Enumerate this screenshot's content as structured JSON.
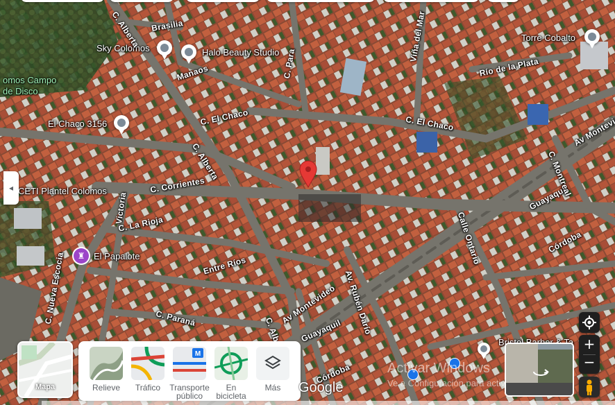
{
  "map": {
    "type": "satellite",
    "colors": {
      "roads": "#7a7870",
      "roofs": "#b5553b",
      "trees": "#2f4a24",
      "pin": "#e53935"
    }
  },
  "pois": [
    {
      "name": "Sky Colomos"
    },
    {
      "name": "Halo Beauty Studio"
    },
    {
      "name": "Torre Cobalto"
    },
    {
      "name": "El Chaco 3156"
    },
    {
      "name": "CETI Plantel Colomos"
    },
    {
      "name": "El Papalote"
    },
    {
      "name": "Bristol Barber & Ta"
    },
    {
      "name": "omos Campo de Disco"
    }
  ],
  "streets": [
    {
      "name": "C. Alberta"
    },
    {
      "name": "Brasilia"
    },
    {
      "name": "Manaos"
    },
    {
      "name": "C. Para"
    },
    {
      "name": "Viña del Mar"
    },
    {
      "name": "Río de la Plata"
    },
    {
      "name": "C. El Chaco"
    },
    {
      "name": "C. El Chaco"
    },
    {
      "name": "Av Montevideo"
    },
    {
      "name": "C. Alberta"
    },
    {
      "name": "C. Corrientes"
    },
    {
      "name": "Victoria"
    },
    {
      "name": "C. La Rioja"
    },
    {
      "name": "Entre Ríos"
    },
    {
      "name": "Av Montevideo"
    },
    {
      "name": "Av. Rubén Darío"
    },
    {
      "name": "C. Nueva Escocia"
    },
    {
      "name": "C. Paraná"
    },
    {
      "name": "Guayaquil"
    },
    {
      "name": "Guayaquil"
    },
    {
      "name": "C. Montreal"
    },
    {
      "name": "Calle Ontario"
    },
    {
      "name": "Córdoba"
    },
    {
      "name": "Córdoba"
    },
    {
      "name": "C. Alb"
    }
  ],
  "layers_panel": {
    "map_button": "Mapa",
    "tools": [
      {
        "label": "Relieve",
        "icon": "terrain-icon"
      },
      {
        "label": "Tráfico",
        "icon": "traffic-icon"
      },
      {
        "label": "Transporte público",
        "icon": "transit-icon"
      },
      {
        "label": "En bicicleta",
        "icon": "bicycle-icon"
      },
      {
        "label": "Más",
        "icon": "layers-icon"
      }
    ]
  },
  "controls": {
    "zoom_in": "+",
    "zoom_out": "−"
  },
  "watermark": {
    "line1": "Activar Windows",
    "line2": "Ve a Configuración para activar Windows."
  },
  "brand": "Google",
  "sidebar_toggle": "◂"
}
